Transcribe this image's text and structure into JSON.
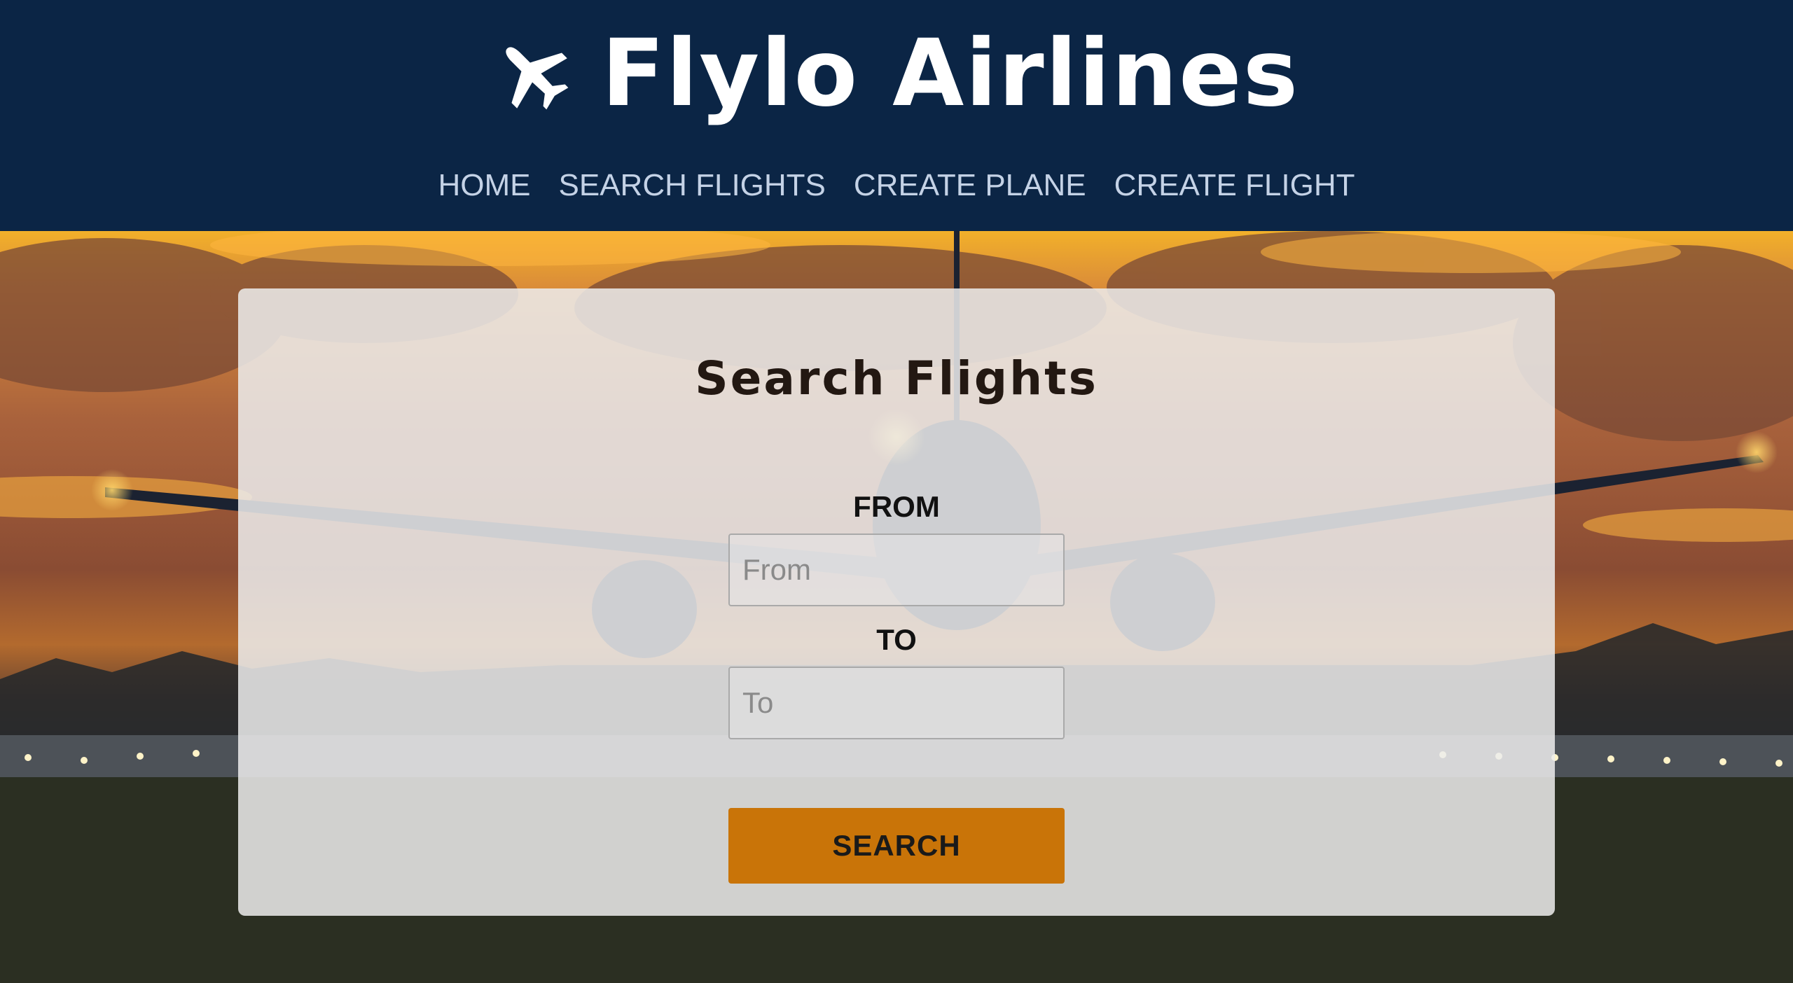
{
  "header": {
    "brand_icon": "airplane-icon",
    "brand_title": "Flylo Airlines",
    "background_color": "#0b2545",
    "nav": [
      {
        "label": "HOME"
      },
      {
        "label": "SEARCH FLIGHTS"
      },
      {
        "label": "CREATE PLANE"
      },
      {
        "label": "CREATE FLIGHT"
      }
    ]
  },
  "hero": {
    "background_image": "airplane-landing-sunset-photo"
  },
  "search_form": {
    "title": "Search Flights",
    "from": {
      "label": "FROM",
      "placeholder": "From",
      "value": ""
    },
    "to": {
      "label": "TO",
      "placeholder": "To",
      "value": ""
    },
    "submit_label": "SEARCH",
    "button_color": "#c97408"
  }
}
